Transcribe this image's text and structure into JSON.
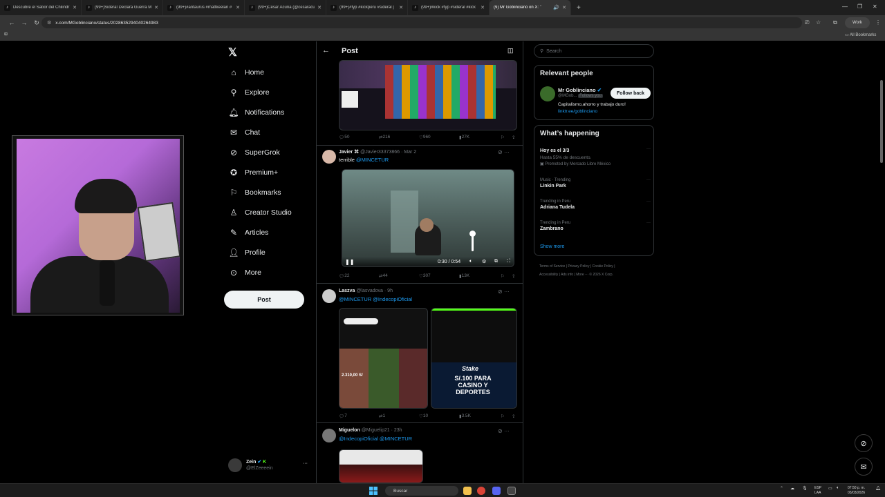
{
  "browser": {
    "tabs": [
      {
        "label": "Descubre el Sabor del Chilindr"
      },
      {
        "label": "(99+)Sideral Declara Guerra M"
      },
      {
        "label": "(99+)#antaurus #mattkeelan #"
      },
      {
        "label": "(99+)César Acuña (@cesaracu"
      },
      {
        "label": "(99+)#fyp #kickperu #sideral |"
      },
      {
        "label": "(99+)#kick #fyp #sideral #kick"
      },
      {
        "label": "(9) Mr Goblinciano on X: \""
      }
    ],
    "url": "x.com/MGoblinciano/status/2028635294040264983",
    "profile_badge": "Work",
    "all_bookmarks": "All Bookmarks"
  },
  "nav": {
    "items": [
      {
        "label": "Home",
        "icon": "home-icon"
      },
      {
        "label": "Explore",
        "icon": "search-icon"
      },
      {
        "label": "Notifications",
        "icon": "bell-icon"
      },
      {
        "label": "Chat",
        "icon": "mail-icon"
      },
      {
        "label": "SuperGrok",
        "icon": "grok-icon"
      },
      {
        "label": "Premium+",
        "icon": "premium-icon"
      },
      {
        "label": "Bookmarks",
        "icon": "bookmark-icon"
      },
      {
        "label": "Creator Studio",
        "icon": "creator-icon"
      },
      {
        "label": "Articles",
        "icon": "article-icon"
      },
      {
        "label": "Profile",
        "icon": "profile-icon"
      },
      {
        "label": "More",
        "icon": "more-icon"
      }
    ],
    "post_button": "Post",
    "account": {
      "name": "Zein",
      "handle": "@ElZeeeein"
    }
  },
  "main": {
    "header_title": "Post",
    "tweets": [
      {
        "actions": {
          "replies": "50",
          "retweets": "216",
          "likes": "960",
          "views": "27K"
        }
      },
      {
        "name": "Javier ⌘",
        "handle": "@Javier33373866",
        "time": "· Mar 2",
        "text_prefix": "terrible",
        "mentions": "@MINCETUR",
        "video_time": "0:30 / 0:54",
        "actions": {
          "replies": "22",
          "retweets": "44",
          "likes": "307",
          "views": "13K"
        }
      },
      {
        "name": "Laszva",
        "handle": "@lasvadova",
        "time": "· 9h",
        "mentions": "@MINCETUR @IndecopiOficial",
        "media_promo": "S/.100 PARA CASINO Y DEPORTES",
        "media_brand": "Stake",
        "media_price": "2.310,00 S/",
        "actions": {
          "replies": "7",
          "retweets": "1",
          "likes": "10",
          "views": "3.5K"
        }
      },
      {
        "name": "Miguelon",
        "handle": "@Miguelip21",
        "time": "· 23h",
        "mentions": "@IndecopiOficial @MINCETUR"
      }
    ]
  },
  "sidebar": {
    "search_placeholder": "Search",
    "relevant_title": "Relevant people",
    "person": {
      "name": "Mr Goblinciano",
      "handle": "@MGob...",
      "follows_you": "Follows you",
      "button": "Follow back",
      "bio": "Capitalismo,ahorro y trabajo duro!",
      "link": "linktr.ee/goblinciano"
    },
    "happening_title": "What’s happening",
    "trends": [
      {
        "context": "",
        "title": "Hoy es el 3/3",
        "sub": "Hasta 55% de descuento.",
        "promo": "Promoted by Mercado Libre México"
      },
      {
        "context": "Music · Trending",
        "title": "Linkin Park"
      },
      {
        "context": "Trending in Peru",
        "title": "Adriana Tudela"
      },
      {
        "context": "Trending in Peru",
        "title": "Zambrano"
      }
    ],
    "show_more": "Show more",
    "footer": [
      "Terms of Service",
      "|",
      "Privacy Policy",
      "|",
      "Cookie Policy",
      "|",
      "Accessibility",
      "|",
      "Ads info",
      "|",
      "More ···",
      "© 2026 X Corp."
    ]
  },
  "taskbar": {
    "search": "Buscar",
    "lang": "ESP",
    "lang2": "LAA",
    "time": "07:50 p. m.",
    "date": "03/03/2026"
  },
  "colors": {
    "accent": "#1d9bf0",
    "background": "#000000",
    "border": "#2f3336"
  }
}
